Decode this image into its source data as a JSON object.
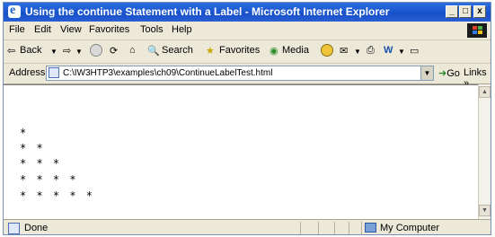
{
  "window": {
    "title": "Using the continue Statement with a Label - Microsoft Internet Explorer",
    "controls": {
      "minimize": "_",
      "maximize": "□",
      "close": "x"
    }
  },
  "menu": [
    "File",
    "Edit",
    "View",
    "Favorites",
    "Tools",
    "Help"
  ],
  "toolbar": {
    "back": "Back",
    "search": "Search",
    "favorites": "Favorites",
    "media": "Media"
  },
  "address": {
    "label": "Address",
    "url": "C:\\IW3HTP3\\examples\\ch09\\ContinueLabelTest.html",
    "go": "Go",
    "links": "Links"
  },
  "content": {
    "rows": [
      "*",
      "* *",
      "* * *",
      "* * * *",
      "* * * * *"
    ]
  },
  "status": {
    "text": "Done",
    "zone": "My Computer"
  },
  "colors": {
    "titlebar": "#1f5fd4",
    "chrome": "#ece9d8",
    "content_bg": "#ffffff"
  }
}
